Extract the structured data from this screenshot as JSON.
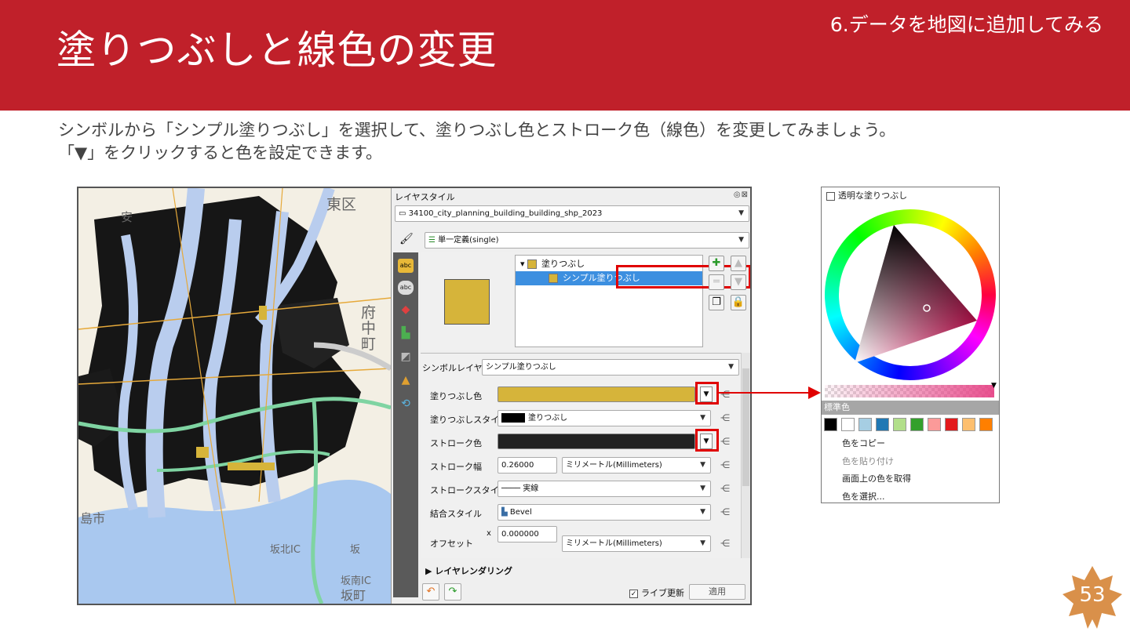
{
  "slide": {
    "title": "塗りつぶしと線色の変更",
    "section": "6.データを地図に追加してみる",
    "desc_line1": "シンボルから「シンプル塗りつぶし」を選択して、塗りつぶし色とストローク色（線色）を変更してみましょう。",
    "desc_line2": "「▼」をクリックすると色を設定できます。",
    "page_number": "53"
  },
  "map": {
    "labels": [
      "東区",
      "安",
      "府",
      "中",
      "町",
      "島市",
      "坂北IC",
      "坂",
      "坂南IC",
      "坂町"
    ]
  },
  "qgis": {
    "panel_title": "レイヤスタイル",
    "window_buttons": "◎⊠",
    "layer_name": "34100_city_planning_building_building_shp_2023",
    "renderer": "単一定義(single)",
    "tree_root": "塗りつぶし",
    "tree_child": "シンプル塗りつぶし",
    "symbol_layer_type_label": "シンボルレイヤ型",
    "symbol_layer_type_value": "シンプル塗りつぶし",
    "fill_color_label": "塗りつぶし色",
    "fill_style_label": "塗りつぶしスタイル",
    "fill_style_value": "塗りつぶし",
    "stroke_color_label": "ストローク色",
    "stroke_width_label": "ストローク幅",
    "stroke_width_value": "0.26000",
    "stroke_width_unit": "ミリメートル(Millimeters)",
    "stroke_style_label": "ストロークスタイル",
    "stroke_style_value": "実線",
    "join_style_label": "結合スタイル",
    "join_style_value": "Bevel",
    "offset_label": "オフセット",
    "offset_x_prefix": "x",
    "offset_x_value": "0.000000",
    "offset_unit": "ミリメートル(Millimeters)",
    "layer_rendering": "レイヤレンダリング",
    "live_update": "ライブ更新",
    "apply": "適用",
    "fill_color": "#d6b43a",
    "stroke_color": "#222222"
  },
  "picker": {
    "transparent_fill": "透明な塗りつぶし",
    "standard_colors_header": "標準色",
    "standard_colors": [
      "#000000",
      "#ffffff",
      "#a6cee3",
      "#1f78b4",
      "#b2df8a",
      "#33a02c",
      "#fb9a99",
      "#e31a1c",
      "#fdbf6f",
      "#ff7f00"
    ],
    "menu": [
      {
        "label": "色をコピー",
        "enabled": true
      },
      {
        "label": "色を貼り付け",
        "enabled": false
      },
      {
        "label": "画面上の色を取得",
        "enabled": true
      },
      {
        "label": "色を選択...",
        "enabled": true
      }
    ]
  },
  "colors": {
    "header_red": "#c0202a",
    "highlight_red": "#e00000",
    "badge_orange": "#d9904a"
  }
}
